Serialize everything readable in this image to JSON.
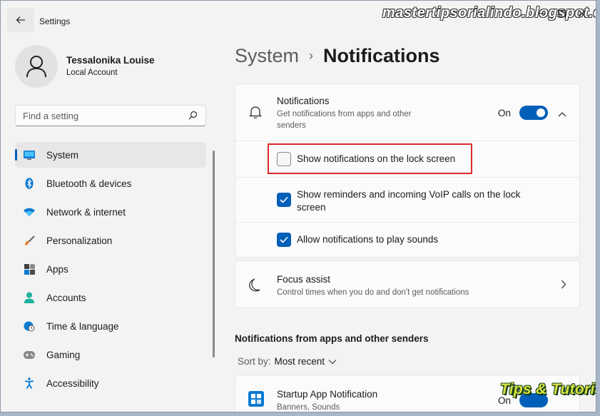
{
  "app": {
    "title": "Settings",
    "watermark": "mastertipsorialindo.blogspot.com"
  },
  "window_controls": [
    "minimize",
    "maximize",
    "close"
  ],
  "user": {
    "name": "Tessalonika Louise",
    "account_type": "Local Account"
  },
  "search": {
    "placeholder": "Find a setting"
  },
  "sidebar": {
    "items": [
      {
        "label": "System",
        "icon": "monitor-icon",
        "selected": true
      },
      {
        "label": "Bluetooth & devices",
        "icon": "bluetooth-icon",
        "selected": false
      },
      {
        "label": "Network & internet",
        "icon": "wifi-icon",
        "selected": false
      },
      {
        "label": "Personalization",
        "icon": "brush-icon",
        "selected": false
      },
      {
        "label": "Apps",
        "icon": "apps-icon",
        "selected": false
      },
      {
        "label": "Accounts",
        "icon": "person-icon",
        "selected": false
      },
      {
        "label": "Time & language",
        "icon": "globe-clock-icon",
        "selected": false
      },
      {
        "label": "Gaming",
        "icon": "gamepad-icon",
        "selected": false
      },
      {
        "label": "Accessibility",
        "icon": "accessibility-icon",
        "selected": false
      }
    ]
  },
  "breadcrumb": {
    "parent": "System",
    "separator": "›",
    "current": "Notifications"
  },
  "notifications": {
    "title": "Notifications",
    "description": "Get notifications from apps and other senders",
    "toggle_label": "On",
    "toggle_on": true,
    "options": [
      {
        "label": "Show notifications on the lock screen",
        "checked": false
      },
      {
        "label": "Show reminders and incoming VoIP calls on the lock screen",
        "checked": true
      },
      {
        "label": "Allow notifications to play sounds",
        "checked": true
      }
    ]
  },
  "focus_assist": {
    "title": "Focus assist",
    "description": "Control times when you do and don't get notifications"
  },
  "senders_section": {
    "title": "Notifications from apps and other senders",
    "sort_label": "Sort by:",
    "sort_value": "Most recent"
  },
  "apps": [
    {
      "name": "Startup App Notification",
      "detail": "Banners, Sounds",
      "toggle_label": "On"
    }
  ],
  "overlay_logo": "Tips & Tutorial",
  "colors": {
    "accent": "#005fb8",
    "highlight_box": "#e0282c",
    "background": "#f3f3f3",
    "card": "#fbfbfb"
  }
}
